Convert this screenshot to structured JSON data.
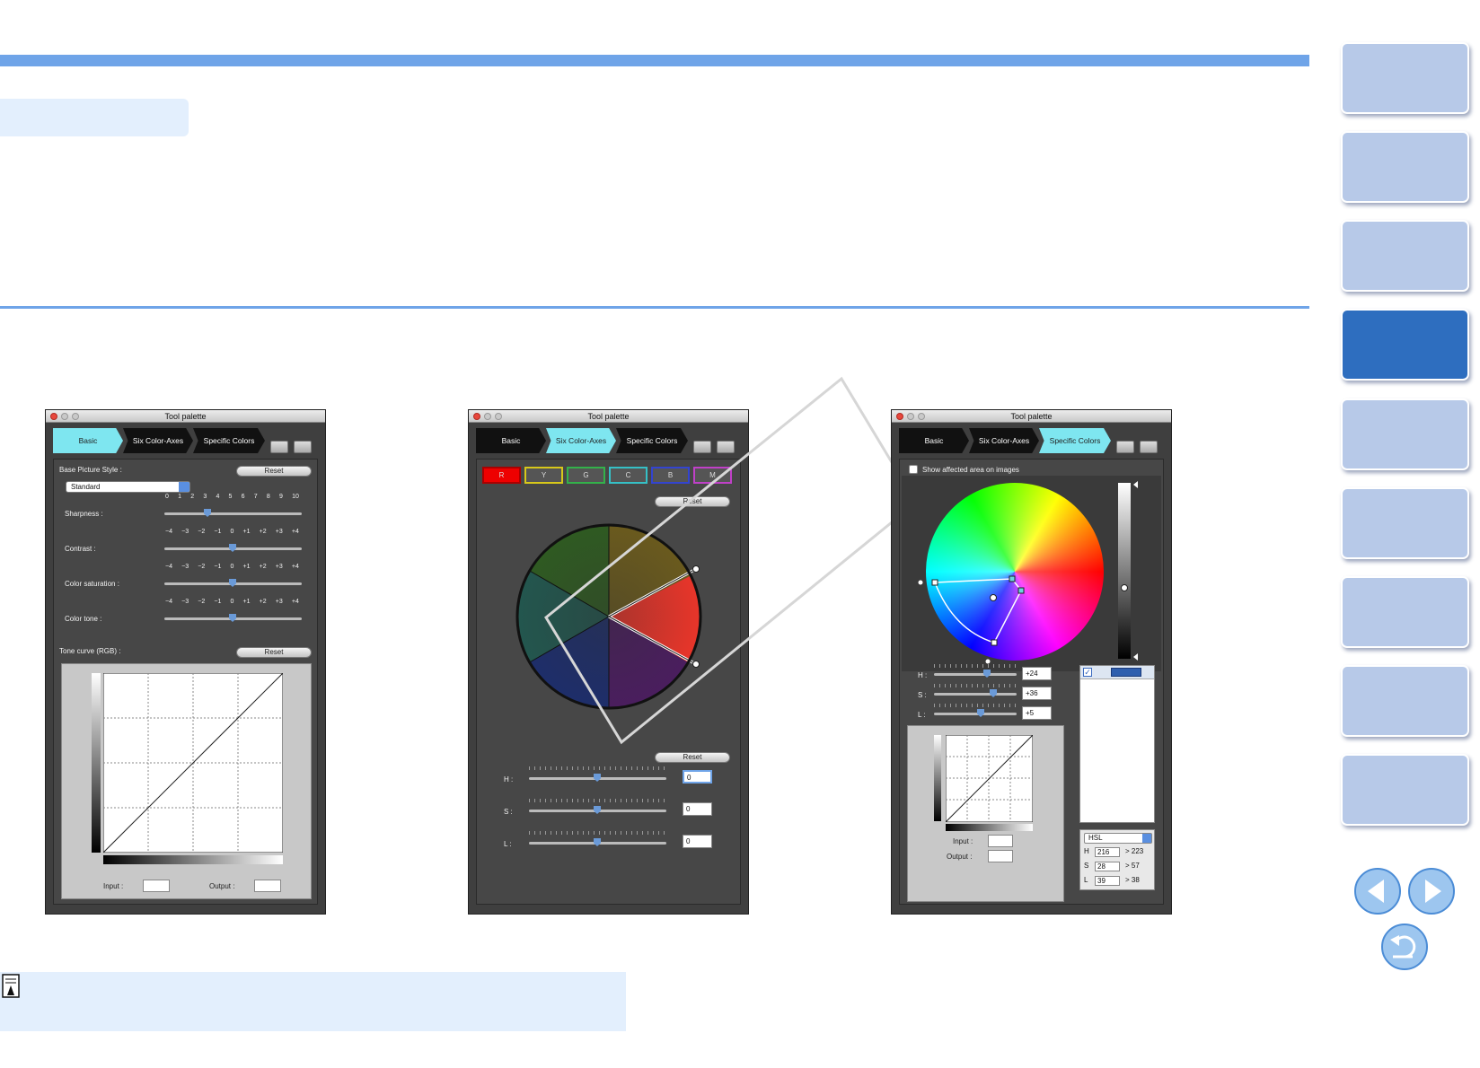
{
  "windows": [
    {
      "title": "Tool palette",
      "tabs": [
        "Basic",
        "Six Color-Axes",
        "Specific Colors"
      ],
      "selected_tab": "Basic",
      "base_picture_style_label": "Base Picture Style :",
      "reset_label": "Reset",
      "picture_style_value": "Standard",
      "sharpness_label": "Sharpness :",
      "sharpness_ticks": [
        "0",
        "1",
        "2",
        "3",
        "4",
        "5",
        "6",
        "7",
        "8",
        "9",
        "10"
      ],
      "sharpness_value": 3,
      "contrast_label": "Contrast :",
      "saturation_label": "Color saturation :",
      "tone_label": "Color tone :",
      "pm_ticks": [
        "−4",
        "−3",
        "−2",
        "−1",
        "0",
        "+1",
        "+2",
        "+3",
        "+4"
      ],
      "contrast_value": 0,
      "saturation_value": 0,
      "tone_value": 0,
      "tone_curve_label": "Tone curve (RGB) :",
      "tone_reset_label": "Reset",
      "input_label": "Input :",
      "output_label": "Output :"
    },
    {
      "title": "Tool palette",
      "tabs": [
        "Basic",
        "Six Color-Axes",
        "Specific Colors"
      ],
      "selected_tab": "Six Color-Axes",
      "color_axes": [
        "R",
        "Y",
        "G",
        "C",
        "B",
        "M"
      ],
      "color_axes_colors": [
        "#ff0000",
        "#d8c81a",
        "#33b24a",
        "#35c0c6",
        "#3344d0",
        "#c040c8"
      ],
      "reset_label": "Reset",
      "reset2_label": "Reset",
      "h_label": "H :",
      "s_label": "S :",
      "l_label": "L :",
      "h_value": "0",
      "s_value": "0",
      "l_value": "0"
    },
    {
      "title": "Tool palette",
      "tabs": [
        "Basic",
        "Six Color-Axes",
        "Specific Colors"
      ],
      "selected_tab": "Specific Colors",
      "show_affected_label": "Show affected area on images",
      "h_label": "H :",
      "s_label": "S :",
      "l_label": "L :",
      "h_value": "+24",
      "s_value": "+36",
      "l_value": "+5",
      "input_label": "Input :",
      "output_label": "Output :",
      "mode_value": "HSL",
      "readout": [
        {
          "label": "H",
          "value": "216",
          "result": "> 223"
        },
        {
          "label": "S",
          "value": "28",
          "result": "> 57"
        },
        {
          "label": "L",
          "value": "39",
          "result": "> 38"
        }
      ],
      "selected_swatch_color": "#2f5fae"
    }
  ],
  "nav": {
    "buttons": 9,
    "active_index": 3,
    "prev_icon": "prev-arrow-icon",
    "next_icon": "next-arrow-icon",
    "return_icon": "return-icon"
  },
  "colors": {
    "accent": "#6fa4e8",
    "nav_button": "#b7c9e8",
    "nav_active": "#2e6ebf",
    "light_box": "#e3effd"
  }
}
